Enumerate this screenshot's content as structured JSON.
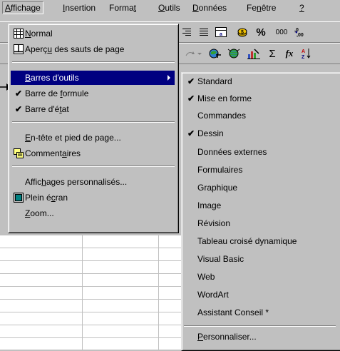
{
  "menubar": {
    "items": [
      {
        "label": "Affichage",
        "accel": "A"
      },
      {
        "label": "Insertion",
        "accel": "I"
      },
      {
        "label": "Format",
        "accel": "t"
      },
      {
        "label": "Outils",
        "accel": "O"
      },
      {
        "label": "Données",
        "accel": "D"
      },
      {
        "label": "Fenêtre",
        "accel": "n"
      },
      {
        "label": "?",
        "accel": "?"
      }
    ]
  },
  "toolbar": {
    "percent_symbol": "%",
    "thousands_symbol": "000",
    "sum_symbol": "Σ",
    "function_symbol": "fx"
  },
  "view_menu": {
    "items": [
      {
        "label": "Normal",
        "accel": "N",
        "icon": "normal-view-icon"
      },
      {
        "label": "Aperçu des sauts de page",
        "accel": "u",
        "icon": "page-break-preview-icon"
      },
      {
        "label": "Barres d'outils",
        "accel": "B",
        "submenu": true
      },
      {
        "label": "Barre de formule",
        "accel": "f",
        "checked": true
      },
      {
        "label": "Barre d'état",
        "accel": "t",
        "checked": true
      },
      {
        "label": "En-tête et pied de page...",
        "accel": "E"
      },
      {
        "label": "Commentaires",
        "accel": "a",
        "icon": "comments-icon"
      },
      {
        "label": "Affichages personnalisés...",
        "accel": "h"
      },
      {
        "label": "Plein écran",
        "accel": "c",
        "icon": "full-screen-icon"
      },
      {
        "label": "Zoom...",
        "accel": "Z"
      }
    ]
  },
  "toolbars_submenu": {
    "items": [
      {
        "label": "Standard",
        "checked": true
      },
      {
        "label": "Mise en forme",
        "checked": true
      },
      {
        "label": "Commandes",
        "checked": false
      },
      {
        "label": "Dessin",
        "checked": true
      },
      {
        "label": "Données externes",
        "checked": false
      },
      {
        "label": "Formulaires",
        "checked": false
      },
      {
        "label": "Graphique",
        "checked": false
      },
      {
        "label": "Image",
        "checked": false
      },
      {
        "label": "Révision",
        "checked": false
      },
      {
        "label": "Tableau croisé dynamique",
        "checked": false
      },
      {
        "label": "Visual Basic",
        "checked": false
      },
      {
        "label": "Web",
        "checked": false
      },
      {
        "label": "WordArt",
        "checked": false
      },
      {
        "label": "Assistant Conseil *",
        "checked": false
      },
      {
        "label": "Personnaliser...",
        "accel": "P"
      }
    ]
  },
  "colors": {
    "menu_bg": "#c0c0c0",
    "highlight": "#000080",
    "highlight_text": "#ffffff"
  }
}
